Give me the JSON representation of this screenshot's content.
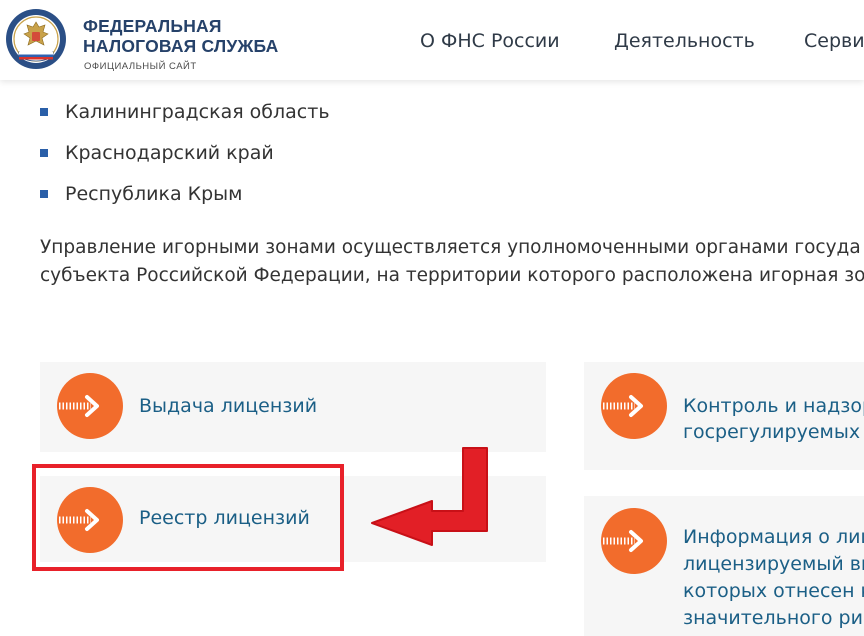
{
  "header": {
    "org_line1": "ФЕДЕРАЛЬНАЯ",
    "org_line2": "НАЛОГОВАЯ СЛУЖБА",
    "org_sub": "ОФИЦИАЛЬНЫЙ САЙТ",
    "emblem_text": "ФЕДЕРАЛЬНАЯ НАЛОГОВАЯ СЛУЖБА"
  },
  "nav": [
    {
      "label": "О ФНС России"
    },
    {
      "label": "Деятельность"
    },
    {
      "label": "Серви"
    }
  ],
  "content": {
    "regions": [
      {
        "label": "Калининградская область"
      },
      {
        "label": "Краснодарский край"
      },
      {
        "label": "Республика Крым"
      }
    ],
    "paragraph_line1": "Управление игорными зонами осуществляется уполномоченными органами госуда",
    "paragraph_line2": "субъекта Российской Федерации, на территории которого расположена игорная зон"
  },
  "cards": {
    "issue_licenses": "Выдача лицензий",
    "license_registry": "Реестр лицензий",
    "control_line1": "Контроль и надзор",
    "control_line2": "госрегулируемых в",
    "info_line1": "Информация о лиц",
    "info_line2": "лицензируемый ви",
    "info_line3": "которых отнесен к",
    "info_line4": "значительного ри"
  },
  "colors": {
    "accent_orange": "#f26c2c",
    "link_blue": "#1b5f86",
    "brand_navy": "#26426a",
    "highlight_red": "#e8212a",
    "bullet_blue": "#2a5fa8"
  },
  "icons": {
    "card_icon": "orange-arrow-circle-icon",
    "annotation": "red-arrow-annotation"
  }
}
